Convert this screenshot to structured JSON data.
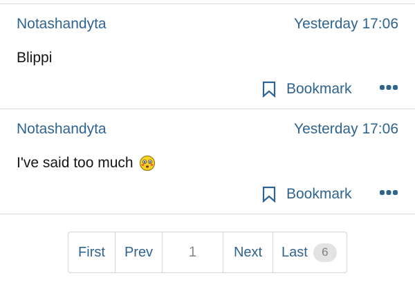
{
  "posts": [
    {
      "username": "Notashandyta",
      "timestamp": "Yesterday 17:06",
      "message": "Blippi",
      "has_emoji": false,
      "bookmark_label": "Bookmark",
      "more_icon": "ellipsis-icon"
    },
    {
      "username": "Notashandyta",
      "timestamp": "Yesterday 17:06",
      "message": "I've said too much",
      "has_emoji": true,
      "emoji_icon": "flushed-face-icon",
      "bookmark_label": "Bookmark",
      "more_icon": "ellipsis-icon"
    }
  ],
  "pagination": {
    "first": "First",
    "prev": "Prev",
    "current": "1",
    "next": "Next",
    "last": "Last",
    "total_pages": "6"
  },
  "colors": {
    "link": "#2f6390",
    "text": "#141414",
    "divider": "#d0d6dc",
    "muted": "#8c8c8c",
    "badge_bg": "#e3e3e3"
  }
}
